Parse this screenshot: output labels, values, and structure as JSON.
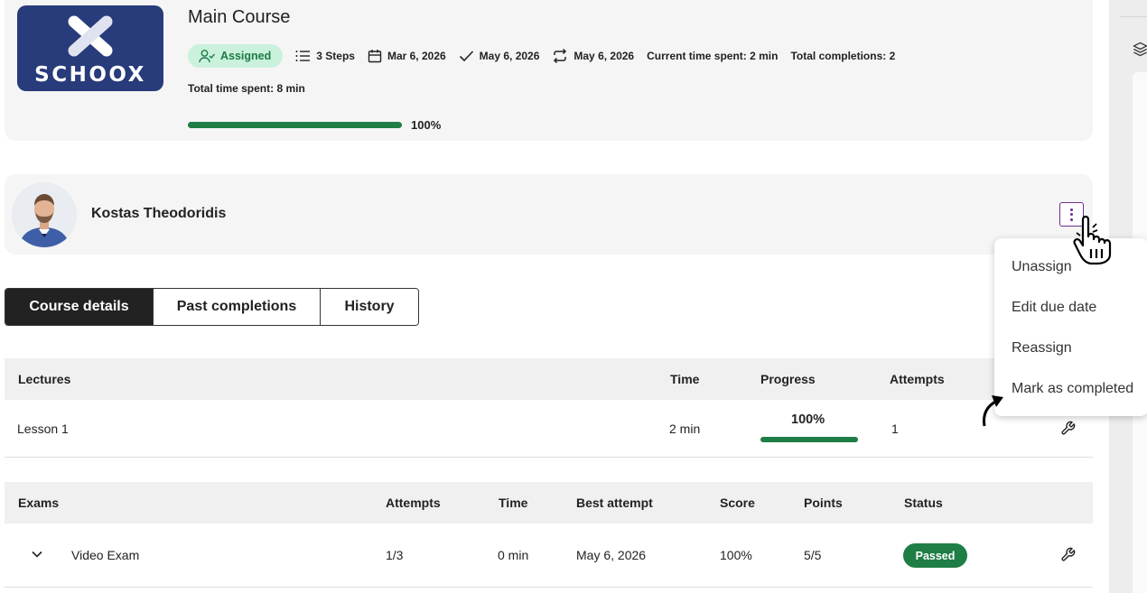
{
  "course": {
    "title": "Main Course",
    "logo_text": "SCHOOX",
    "status_badge": "Assigned",
    "steps": "3 Steps",
    "assigned_date": "Mar 6, 2026",
    "completed_date": "May 6, 2026",
    "recurring_date": "May 6, 2026",
    "current_time_spent": "Current time spent: 2 min",
    "total_completions": "Total completions: 2",
    "total_time_spent": "Total time spent: 8 min",
    "progress_label": "100%",
    "progress_value": 1.0
  },
  "user": {
    "name": "Kostas Theodoridis"
  },
  "tabs": [
    {
      "label": "Course details",
      "active": true
    },
    {
      "label": "Past completions",
      "active": false
    },
    {
      "label": "History",
      "active": false
    }
  ],
  "lectures": {
    "headers": {
      "name": "Lectures",
      "time": "Time",
      "progress": "Progress",
      "attempts": "Attempts"
    },
    "rows": [
      {
        "name": "Lesson 1",
        "time": "2 min",
        "progress": "100%",
        "progress_value": 1.0,
        "attempts": "1"
      }
    ]
  },
  "exams": {
    "headers": {
      "name": "Exams",
      "attempts": "Attempts",
      "time": "Time",
      "best_attempt": "Best attempt",
      "score": "Score",
      "points": "Points",
      "status": "Status"
    },
    "rows": [
      {
        "name": "Video Exam",
        "attempts": "1/3",
        "time": "0 min",
        "best_attempt": "May 6, 2026",
        "score": "100%",
        "points": "5/5",
        "status": "Passed"
      }
    ]
  },
  "context_menu": {
    "items": [
      "Unassign",
      "Edit due date",
      "Reassign",
      "Mark as completed"
    ]
  },
  "colors": {
    "brand_navy": "#283b7a",
    "success_green": "#1e7e45",
    "badge_bg": "#c9f1dc",
    "accent_purple": "#6c2d91"
  },
  "icons": [
    "user-check-icon",
    "list-icon",
    "calendar-icon",
    "check-icon",
    "repeat-icon",
    "kebab-menu-icon",
    "hand-cursor-icon",
    "chevron-down-icon",
    "wrench-icon",
    "layers-icon",
    "curved-arrow-icon"
  ]
}
